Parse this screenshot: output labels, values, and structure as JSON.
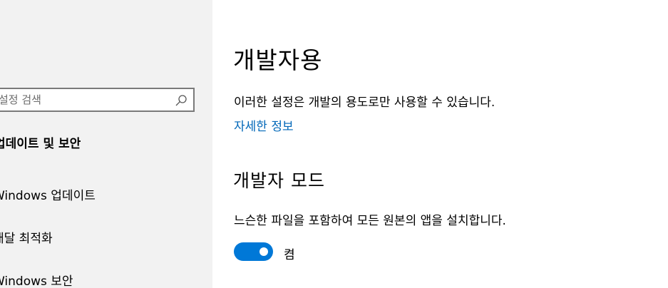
{
  "sidebar": {
    "search": {
      "value": "",
      "placeholder": "설정 검색"
    },
    "heading": "업데이트 및 보안",
    "items": [
      {
        "label": "Windows 업데이트",
        "icon": "refresh-icon"
      },
      {
        "label": "배달 최적화",
        "icon": "delivery-optimization-icon"
      },
      {
        "label": "Windows 보안",
        "icon": "shield-icon"
      }
    ]
  },
  "main": {
    "title": "개발자용",
    "description": "이러한 설정은 개발의 용도로만 사용할 수 있습니다.",
    "more_info_link": "자세한 정보",
    "developer_mode": {
      "title": "개발자 모드",
      "description": "느슨한 파일을 포함하여 모든 원본의 앱을 설치합니다.",
      "toggle_state": "켬",
      "enabled": true
    }
  },
  "colors": {
    "accent": "#0078d7",
    "link": "#0067b8",
    "sidebar_background": "#f2f2f2"
  }
}
